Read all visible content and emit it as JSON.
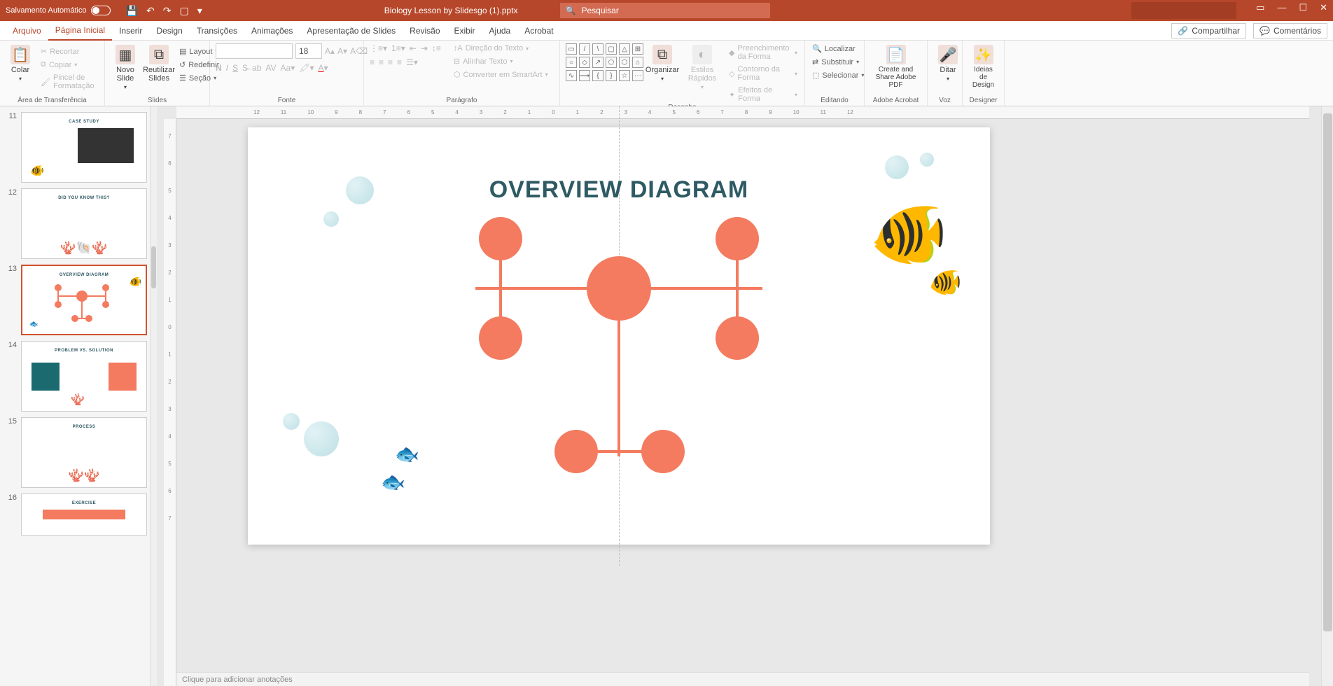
{
  "title_bar": {
    "autosave_label": "Salvamento Automático",
    "doc_title": "Biology Lesson by Slidesgo (1).pptx",
    "search_placeholder": "Pesquisar"
  },
  "tabs": {
    "file": "Arquivo",
    "home": "Página Inicial",
    "insert": "Inserir",
    "design": "Design",
    "transitions": "Transições",
    "animations": "Animações",
    "slideshow": "Apresentação de Slides",
    "review": "Revisão",
    "view": "Exibir",
    "help": "Ajuda",
    "acrobat": "Acrobat"
  },
  "actions": {
    "share": "Compartilhar",
    "comments": "Comentários"
  },
  "ribbon": {
    "clipboard": {
      "paste": "Colar",
      "cut": "Recortar",
      "copy": "Copiar",
      "format_painter": "Pincel de Formatação",
      "label": "Área de Transferência"
    },
    "slides": {
      "new_slide": "Novo Slide",
      "reuse": "Reutilizar Slides",
      "layout": "Layout",
      "reset": "Redefinir",
      "section": "Seção",
      "label": "Slides"
    },
    "font": {
      "size": "18",
      "label": "Fonte"
    },
    "paragraph": {
      "text_direction": "Direção do Texto",
      "align_text": "Alinhar Texto",
      "convert_smartart": "Converter em SmartArt",
      "label": "Parágrafo"
    },
    "drawing": {
      "arrange": "Organizar",
      "quick_styles": "Estilos Rápidos",
      "shape_fill": "Preenchimento da Forma",
      "shape_outline": "Contorno da Forma",
      "shape_effects": "Efeitos de Forma",
      "label": "Desenho"
    },
    "editing": {
      "find": "Localizar",
      "replace": "Substituir",
      "select": "Selecionar",
      "label": "Editando"
    },
    "acrobat": {
      "create_share": "Create and Share Adobe PDF",
      "label": "Adobe Acrobat"
    },
    "voice": {
      "dictate": "Ditar",
      "label": "Voz"
    },
    "designer": {
      "ideas": "Ideias de Design",
      "label": "Designer"
    }
  },
  "thumbs": {
    "n11": "11",
    "n12": "12",
    "n13": "13",
    "n14": "14",
    "n15": "15",
    "n16": "16",
    "t11": "CASE STUDY",
    "t12": "DID YOU KNOW THIS?",
    "t13": "OVERVIEW DIAGRAM",
    "t14": "PROBLEM VS. SOLUTION",
    "t15": "PROCESS",
    "t16": "EXERCISE"
  },
  "slide": {
    "title": "OVERVIEW DIAGRAM"
  },
  "notes": {
    "placeholder": "Clique para adicionar anotações"
  },
  "ruler": {
    "h": [
      "12",
      "11",
      "10",
      "9",
      "8",
      "7",
      "6",
      "5",
      "4",
      "3",
      "2",
      "1",
      "0",
      "1",
      "2",
      "3",
      "4",
      "5",
      "6",
      "7",
      "8",
      "9",
      "10",
      "11",
      "12"
    ],
    "v": [
      "7",
      "6",
      "5",
      "4",
      "3",
      "2",
      "1",
      "0",
      "1",
      "2",
      "3",
      "4",
      "5",
      "6",
      "7"
    ]
  }
}
